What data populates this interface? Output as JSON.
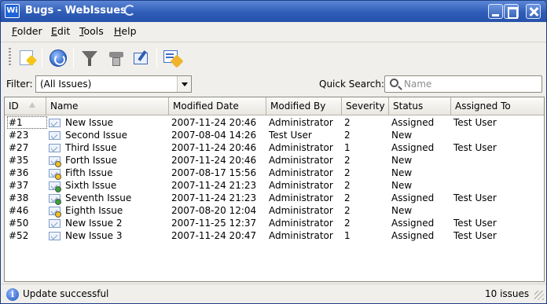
{
  "window": {
    "title": "Bugs - WebIssues",
    "app_icon_text": "Wi"
  },
  "menubar": {
    "items": [
      {
        "label": "Folder",
        "accel": "F"
      },
      {
        "label": "Edit",
        "accel": "E"
      },
      {
        "label": "Tools",
        "accel": "T"
      },
      {
        "label": "Help",
        "accel": "H"
      }
    ]
  },
  "toolbar": {
    "buttons": [
      {
        "name": "add-issue",
        "icon": "new-issue-icon"
      },
      {
        "name": "update-folder",
        "icon": "refresh-icon"
      },
      {
        "name": "filter",
        "icon": "filter-icon"
      },
      {
        "name": "manage-filters",
        "icon": "filter-manage-icon"
      },
      {
        "name": "manage-alerts",
        "icon": "edit-icon"
      },
      {
        "name": "view-settings",
        "icon": "view-settings-icon"
      }
    ]
  },
  "filter": {
    "label": "Filter:",
    "value": "(All Issues)"
  },
  "quick_search": {
    "label": "Quick Search:",
    "placeholder": "Name"
  },
  "table": {
    "columns": [
      "ID",
      "Name",
      "Modified Date",
      "Modified By",
      "Severity",
      "Status",
      "Assigned To"
    ],
    "rows": [
      {
        "id": "#1",
        "name": "New Issue",
        "modified_date": "2007-11-24 20:46",
        "modified_by": "Administrator",
        "severity": "2",
        "status": "Assigned",
        "assigned_to": "Test User",
        "badge": "none"
      },
      {
        "id": "#23",
        "name": "Second Issue",
        "modified_date": "2007-08-04 14:26",
        "modified_by": "Test User",
        "severity": "2",
        "status": "New",
        "assigned_to": "",
        "badge": "none"
      },
      {
        "id": "#27",
        "name": "Third Issue",
        "modified_date": "2007-11-24 20:46",
        "modified_by": "Administrator",
        "severity": "1",
        "status": "Assigned",
        "assigned_to": "Test User",
        "badge": "none"
      },
      {
        "id": "#35",
        "name": "Forth Issue",
        "modified_date": "2007-11-24 20:46",
        "modified_by": "Administrator",
        "severity": "2",
        "status": "New",
        "assigned_to": "",
        "badge": "yellow"
      },
      {
        "id": "#36",
        "name": "Fifth Issue",
        "modified_date": "2007-08-17 15:56",
        "modified_by": "Administrator",
        "severity": "2",
        "status": "New",
        "assigned_to": "",
        "badge": "yellow"
      },
      {
        "id": "#37",
        "name": "Sixth Issue",
        "modified_date": "2007-11-24 21:23",
        "modified_by": "Administrator",
        "severity": "2",
        "status": "New",
        "assigned_to": "",
        "badge": "green"
      },
      {
        "id": "#38",
        "name": "Seventh Issue",
        "modified_date": "2007-11-24 21:23",
        "modified_by": "Administrator",
        "severity": "2",
        "status": "Assigned",
        "assigned_to": "Test User",
        "badge": "green"
      },
      {
        "id": "#46",
        "name": "Eighth Issue",
        "modified_date": "2007-08-20 12:04",
        "modified_by": "Administrator",
        "severity": "2",
        "status": "New",
        "assigned_to": "",
        "badge": "yellow"
      },
      {
        "id": "#50",
        "name": "New Issue 2",
        "modified_date": "2007-11-25 12:37",
        "modified_by": "Administrator",
        "severity": "2",
        "status": "Assigned",
        "assigned_to": "Test User",
        "badge": "none"
      },
      {
        "id": "#52",
        "name": "New Issue 3",
        "modified_date": "2007-11-24 20:47",
        "modified_by": "Administrator",
        "severity": "1",
        "status": "Assigned",
        "assigned_to": "Test User",
        "badge": "none"
      }
    ]
  },
  "status": {
    "message": "Update successful",
    "count": "10 issues"
  },
  "colors": {
    "title_bar": "#2f5cb7",
    "badge_yellow": "#f3c21b",
    "badge_green": "#33a33a"
  }
}
